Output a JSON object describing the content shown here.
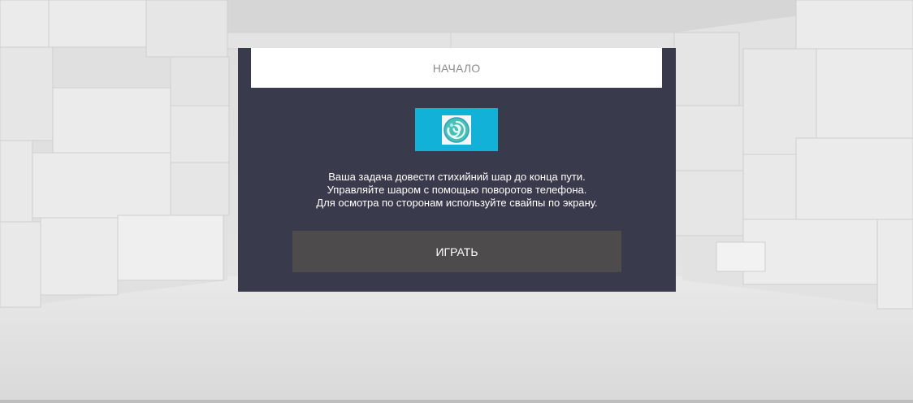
{
  "menu": {
    "title": "НАЧАЛО",
    "logo_icon": "ball-logo-icon",
    "instructions": [
      "Ваша задача довести стихийний шар до конца пути.",
      "Управляйте шаром с помощью поворотов телефона.",
      "Для осмотра по сторонам используйте свайпы по экрану."
    ],
    "play_label": "ИГРАТЬ"
  },
  "colors": {
    "panel": "#393a4b",
    "header": "#ffffff",
    "logo_bg": "#12b2d8",
    "play_button": "#4d4b4b",
    "text": "#ffffff",
    "header_text": "#8d8d8d",
    "environment": "#e4e4e4"
  }
}
